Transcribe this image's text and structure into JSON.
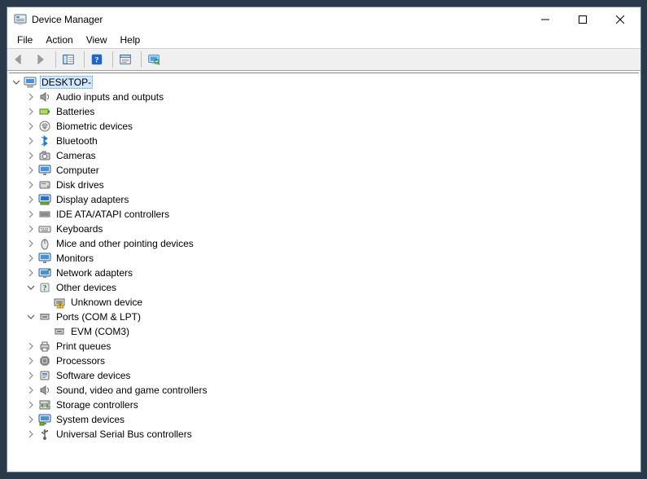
{
  "window": {
    "title": "Device Manager"
  },
  "menubar": {
    "items": [
      "File",
      "Action",
      "View",
      "Help"
    ]
  },
  "toolbar": {
    "buttons": [
      {
        "name": "back-button",
        "icon": "arrow-left",
        "disabled": true
      },
      {
        "name": "forward-button",
        "icon": "arrow-right",
        "disabled": true
      },
      {
        "sep": true
      },
      {
        "name": "show-hide-tree-button",
        "icon": "tree-pane",
        "disabled": false
      },
      {
        "sep": true
      },
      {
        "name": "help-button",
        "icon": "help-blue",
        "disabled": false
      },
      {
        "sep": true
      },
      {
        "name": "properties-button",
        "icon": "props",
        "disabled": false
      },
      {
        "sep": true
      },
      {
        "name": "scan-hardware-button",
        "icon": "scan-monitor",
        "disabled": false
      }
    ]
  },
  "tree": {
    "root": {
      "label": "DESKTOP-",
      "icon": "computer",
      "selected": true,
      "expanded": true,
      "children": [
        {
          "label": "Audio inputs and outputs",
          "icon": "speaker",
          "expandable": true
        },
        {
          "label": "Batteries",
          "icon": "battery",
          "expandable": true
        },
        {
          "label": "Biometric devices",
          "icon": "biometric",
          "expandable": true
        },
        {
          "label": "Bluetooth",
          "icon": "bluetooth",
          "expandable": true
        },
        {
          "label": "Cameras",
          "icon": "camera",
          "expandable": true
        },
        {
          "label": "Computer",
          "icon": "monitor",
          "expandable": true
        },
        {
          "label": "Disk drives",
          "icon": "disk",
          "expandable": true
        },
        {
          "label": "Display adapters",
          "icon": "display",
          "expandable": true
        },
        {
          "label": "IDE ATA/ATAPI controllers",
          "icon": "ide",
          "expandable": true
        },
        {
          "label": "Keyboards",
          "icon": "keyboard",
          "expandable": true
        },
        {
          "label": "Mice and other pointing devices",
          "icon": "mouse",
          "expandable": true
        },
        {
          "label": "Monitors",
          "icon": "monitor",
          "expandable": true
        },
        {
          "label": "Network adapters",
          "icon": "network",
          "expandable": true
        },
        {
          "label": "Other devices",
          "icon": "question",
          "expandable": true,
          "expanded": true,
          "children": [
            {
              "label": "Unknown device",
              "icon": "warning-chip",
              "expandable": false
            }
          ]
        },
        {
          "label": "Ports (COM & LPT)",
          "icon": "port",
          "expandable": true,
          "expanded": true,
          "children": [
            {
              "label": "EVM (COM3)",
              "icon": "port",
              "expandable": false
            }
          ]
        },
        {
          "label": "Print queues",
          "icon": "printer",
          "expandable": true
        },
        {
          "label": "Processors",
          "icon": "cpu",
          "expandable": true
        },
        {
          "label": "Software devices",
          "icon": "software",
          "expandable": true
        },
        {
          "label": "Sound, video and game controllers",
          "icon": "speaker",
          "expandable": true
        },
        {
          "label": "Storage controllers",
          "icon": "storage",
          "expandable": true
        },
        {
          "label": "System devices",
          "icon": "system",
          "expandable": true
        },
        {
          "label": "Universal Serial Bus controllers",
          "icon": "usb",
          "expandable": true
        }
      ]
    }
  }
}
